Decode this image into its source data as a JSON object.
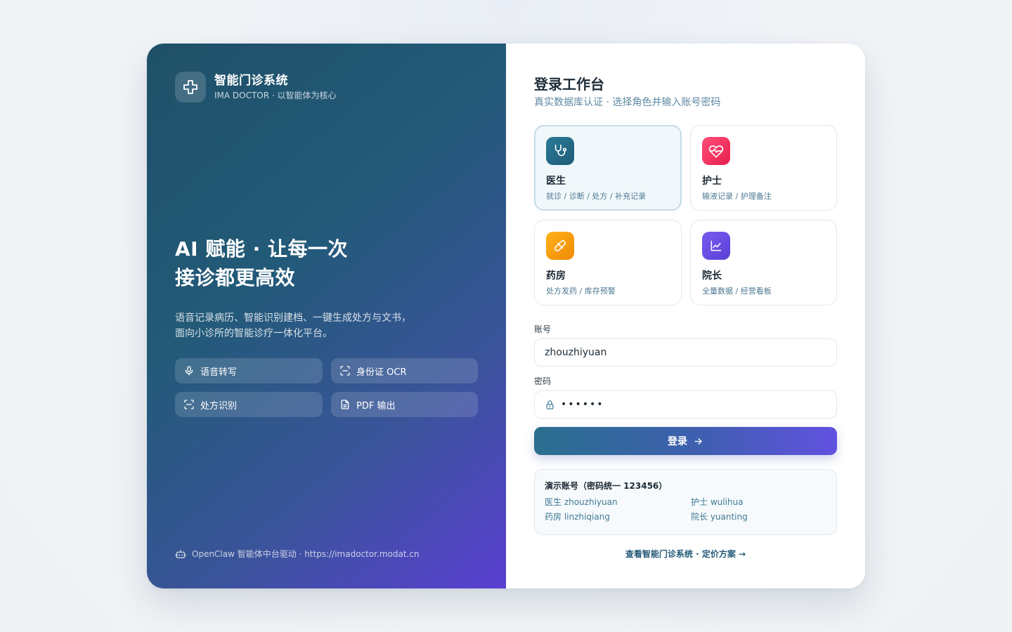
{
  "brand": {
    "title": "智能门诊系统",
    "subtitle": "IMA DOCTOR · 以智能体为核心"
  },
  "hero": {
    "line1": "AI 赋能 · 让每一次",
    "line2": "接诊都更高效"
  },
  "description": {
    "line1": "语音记录病历、智能识别建档、一键生成处方与文书，",
    "line2": "面向小诊所的智能诊疗一体化平台。"
  },
  "features": [
    {
      "label": "语音转写",
      "icon": "microphone-icon"
    },
    {
      "label": "身份证 OCR",
      "icon": "scan-icon"
    },
    {
      "label": "处方识别",
      "icon": "scan-icon"
    },
    {
      "label": "PDF 输出",
      "icon": "document-icon"
    }
  ],
  "footer": {
    "text": "OpenClaw 智能体中台驱动 · https://imadoctor.modat.cn",
    "icon": "robot-icon"
  },
  "login": {
    "title": "登录工作台",
    "subtitle": "真实数据库认证 · 选择角色并输入账号密码",
    "roles": [
      {
        "name": "医生",
        "desc": "就诊 / 诊断 / 处方 / 补充记录",
        "icon": "stethoscope-icon",
        "color": "#1f6a86",
        "selected": true
      },
      {
        "name": "护士",
        "desc": "输液记录 / 护理备注",
        "icon": "heart-pulse-icon",
        "color": "#f0315c",
        "selected": false
      },
      {
        "name": "药房",
        "desc": "处方发药 / 库存预警",
        "icon": "pill-icon",
        "color": "#f29a0c",
        "selected": false
      },
      {
        "name": "院长",
        "desc": "全量数据 / 经营看板",
        "icon": "chart-icon",
        "color": "#6a4fe0",
        "selected": false
      }
    ],
    "account_label": "账号",
    "account_value": "zhouzhiyuan",
    "password_label": "密码",
    "password_value": "••••••",
    "submit_label": "登录",
    "demo": {
      "title": "演示账号（密码统一 123456）",
      "accounts": [
        "医生 zhouzhiyuan",
        "护士 wulihua",
        "药房 linzhiqiang",
        "院长 yuanting"
      ]
    },
    "pricing_link": "查看智能门诊系统 · 定价方案 →"
  }
}
